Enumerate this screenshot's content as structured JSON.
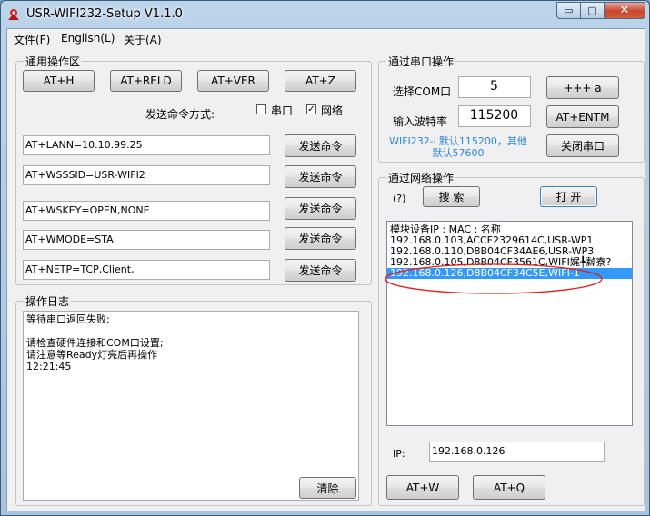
{
  "window": {
    "title": "USR-WIFI232-Setup V1.1.0",
    "min_glyph": "▭",
    "max_glyph": "▢",
    "close_glyph": "✕"
  },
  "menu": [
    "文件(F)",
    "English(L)",
    "关于(A)"
  ],
  "general": {
    "legend": "通用操作区",
    "buttons": [
      "AT+H",
      "AT+RELD",
      "AT+VER",
      "AT+Z"
    ],
    "send_mode_label": "发送命令方式:",
    "serial_label": "串口",
    "network_label": "网络",
    "serial_checked": false,
    "network_checked": true,
    "check_mark": "✓",
    "commands": [
      "AT+LANN=10.10.99.25",
      "AT+WSSSID=USR-WIFI2",
      "AT+WSKEY=OPEN,NONE",
      "AT+WMODE=STA",
      "AT+NETP=TCP,Client,"
    ],
    "send_label": "发送命令"
  },
  "log": {
    "legend": "操作日志",
    "text": "等待串口返回失败:\n\n请检查硬件连接和COM口设置;\n请注意等Ready灯亮后再操作\n12:21:45",
    "clear_label": "清除"
  },
  "serial": {
    "legend": "通过串口操作",
    "com_label": "选择COM口",
    "com_value": "5",
    "baud_label": "输入波特率",
    "baud_value": "115200",
    "plus_btn": "+++ a",
    "entm_btn": "AT+ENTM",
    "hint_line1": "WIFI232-L默认115200，其他",
    "hint_line2": "默认57600",
    "close_btn": "关闭串口"
  },
  "network": {
    "legend": "通过网络操作",
    "question": "(?)",
    "search_btn": "搜 索",
    "open_btn": "打 开",
    "list_header": " 模块设备IP  :  MAC  :  名称",
    "devices": [
      "192.168.0.103,ACCF2329614C,USR-WP1",
      "192.168.0.110,D8B04CF34AE6,USR-WP3",
      "192.168.0.105,D8B04CF3561C,WIFI娓╄繛寮?",
      "192.168.0.126,D8B04CF34C5E,WIFI-1"
    ],
    "selected_index": 3,
    "ip_label": "IP:",
    "ip_value": "192.168.0.126",
    "atw_btn": "AT+W",
    "atq_btn": "AT+Q"
  },
  "colors": {
    "selection": "#3399ff",
    "annotation": "#e02020",
    "hint": "#2e87d8"
  }
}
